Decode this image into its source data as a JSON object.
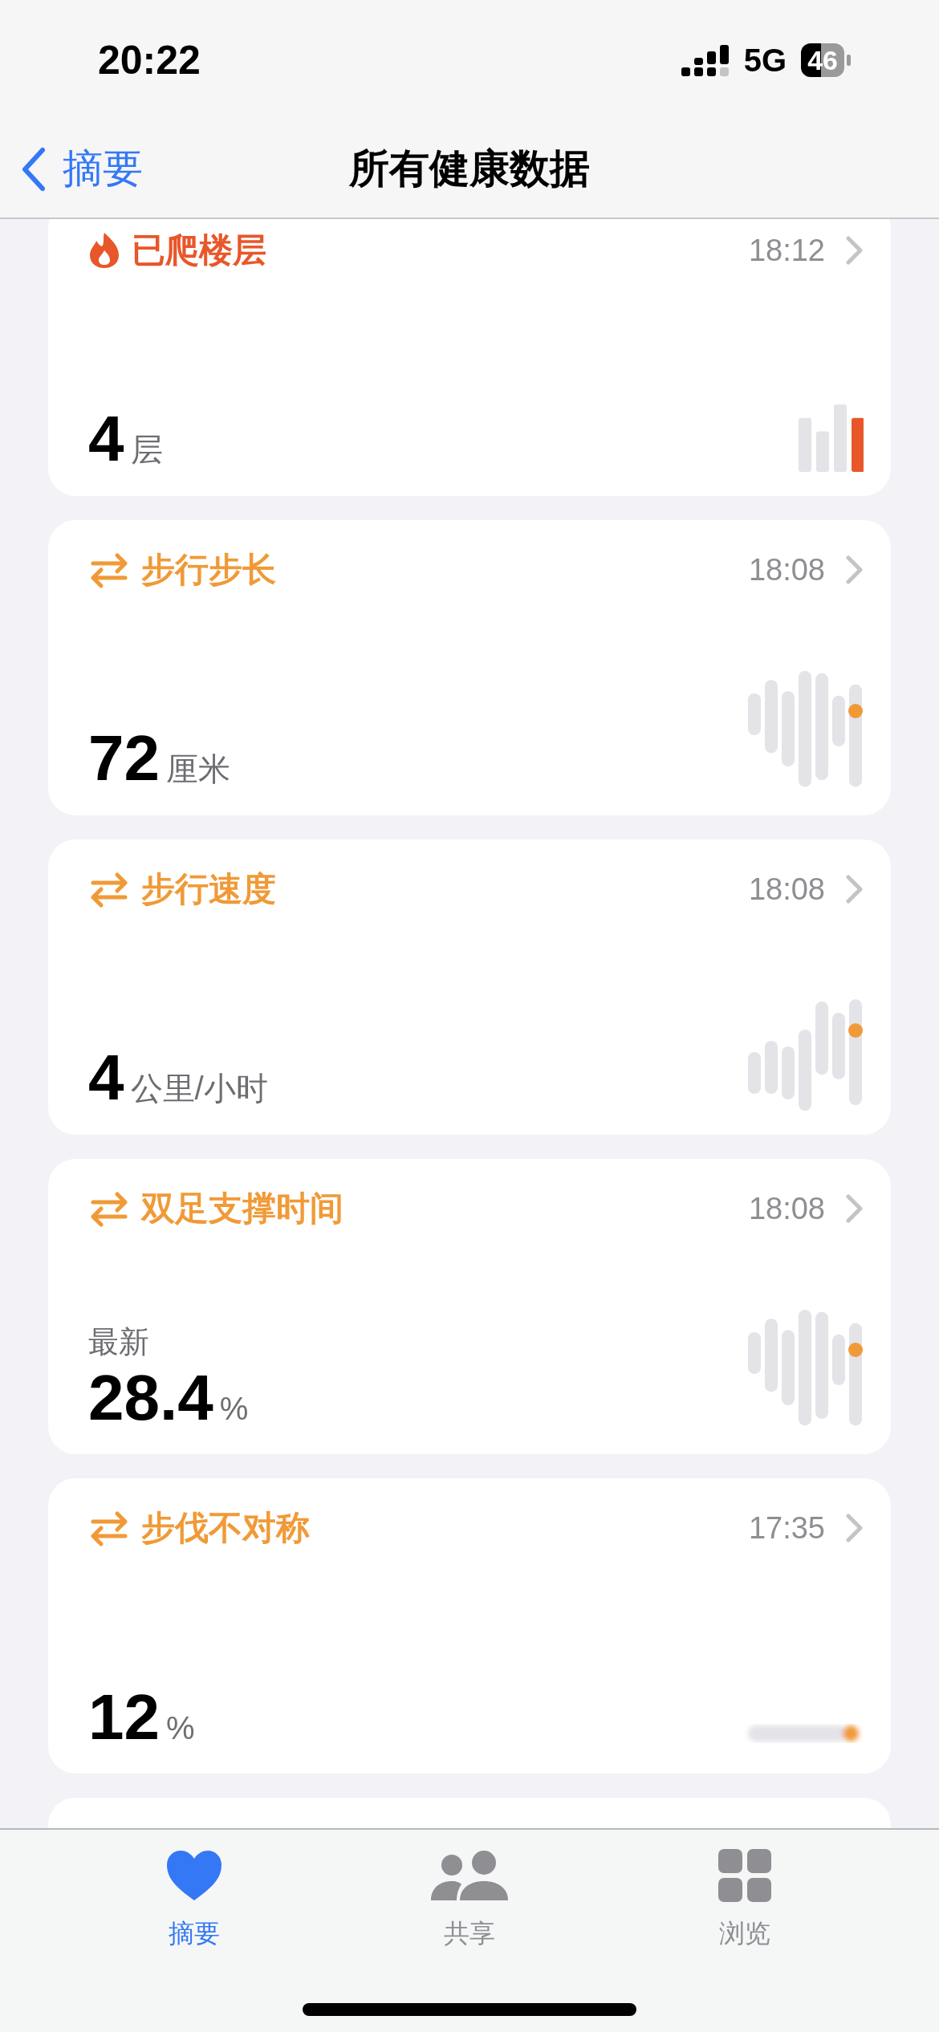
{
  "status_bar": {
    "time": "20:22",
    "network": "5G",
    "battery": "46"
  },
  "nav": {
    "back": "摘要",
    "title": "所有健康数据"
  },
  "cards": [
    {
      "title": "已爬楼层",
      "kind": "bars",
      "color": "#e8572a",
      "time": "18:12",
      "value": "4",
      "unit": "层"
    },
    {
      "title": "步行步长",
      "kind": "range",
      "color": "#f09a37",
      "time": "18:08",
      "value": "72",
      "unit": "厘米"
    },
    {
      "title": "步行速度",
      "kind": "range",
      "color": "#f09a37",
      "time": "18:08",
      "value": "4",
      "unit": "公里/小时"
    },
    {
      "title": "双足支撑时间",
      "kind": "range",
      "color": "#f09a37",
      "time": "18:08",
      "caption": "最新",
      "value": "28.4",
      "unit": "%"
    },
    {
      "title": "步伐不对称",
      "kind": "blurred",
      "color": "#f09a37",
      "time": "17:35",
      "value": "12",
      "unit": "%"
    }
  ],
  "tabs": [
    {
      "label": "摘要",
      "selected": true
    },
    {
      "label": "共享",
      "selected": false
    },
    {
      "label": "浏览",
      "selected": false
    }
  ]
}
